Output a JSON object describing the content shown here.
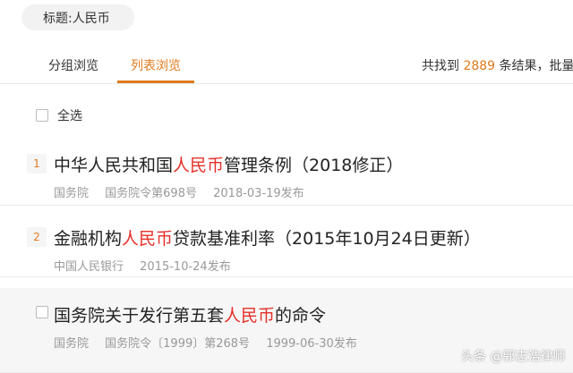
{
  "filter_chip": "标题:人民币",
  "tabs": [
    {
      "label": "分组浏览"
    },
    {
      "label": "列表浏览"
    }
  ],
  "summary": {
    "prefix": "共找到",
    "count": "2889",
    "suffix": "条结果，批量"
  },
  "select_all_label": "全选",
  "results": [
    {
      "index": "1",
      "title_before": "中华人民共和国",
      "title_highlight": "人民币",
      "title_after": "管理条例（2018修正）",
      "meta": [
        "国务院",
        "国务院令第698号",
        "2018-03-19发布"
      ]
    },
    {
      "index": "2",
      "title_before": "金融机构",
      "title_highlight": "人民币",
      "title_after": "贷款基准利率（2015年10月24日更新）",
      "meta": [
        "中国人民银行",
        "2015-10-24发布"
      ]
    },
    {
      "title_before": "国务院关于发行第五套",
      "title_highlight": "人民币",
      "title_after": "的命令",
      "meta": [
        "国务院",
        "国务院令〔1999〕第268号",
        "1999-06-30发布"
      ]
    }
  ],
  "watermark": "头条 @郭志浩律师",
  "colors": {
    "accent": "#e07a1f",
    "highlight": "#e5312a"
  }
}
